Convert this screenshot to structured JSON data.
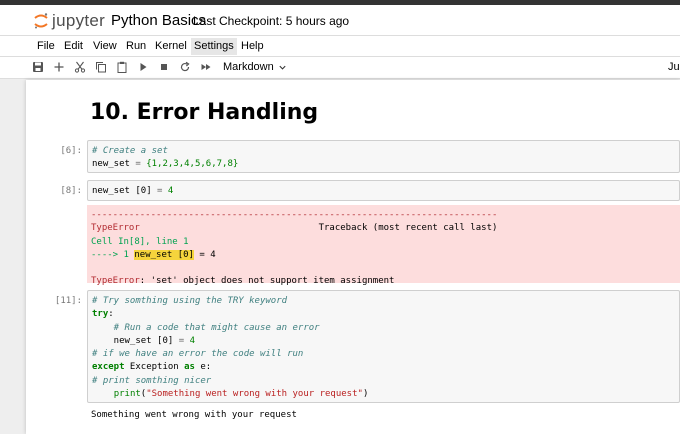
{
  "app": {
    "logo_text": "jupyter",
    "notebook_title": "Python Basics",
    "checkpoint": "Last Checkpoint: 5 hours ago",
    "kernel_name": "Jup"
  },
  "menu": [
    "File",
    "Edit",
    "View",
    "Run",
    "Kernel",
    "Settings",
    "Help"
  ],
  "toolbar": {
    "icons": [
      "save-icon",
      "add-icon",
      "cut-icon",
      "copy-icon",
      "paste-icon",
      "run-icon",
      "stop-icon",
      "restart-icon",
      "fast-forward-icon"
    ],
    "cell_type": "Markdown"
  },
  "heading": "10. Error Handling",
  "cells": {
    "c6": {
      "prompt": "[6]:",
      "line1": "# Create a set",
      "line2_var": "new_set",
      "line2_eq": " = ",
      "line2_val": "{1,2,3,4,5,6,7,8}"
    },
    "c8": {
      "prompt": "[8]:",
      "line1_var": "new_set ",
      "line1_idx": "[0]",
      "line1_eq": " = ",
      "line1_val": "4",
      "err_divider": "---------------------------------------------------------------------------",
      "err_type": "TypeError",
      "err_traceback": "                                 Traceback (most recent call last)",
      "err_cell": "Cell In[8], line 1",
      "err_arrow": "----> 1 ",
      "err_hl": "new_set [0]",
      "err_rest": " = 4",
      "err_msg_type": "TypeError",
      "err_msg": ": 'set' object does not support item assignment"
    },
    "c11": {
      "prompt": "[11]:",
      "l1": "# Try somthing using the TRY keyword",
      "l2_kw": "try",
      "l2_rest": ":",
      "l3": "    # Run a code that might cause an error",
      "l4_var": "    new_set ",
      "l4_idx": "[0]",
      "l4_eq": " = ",
      "l4_val": "4",
      "l5": "# if we have an error the code will run",
      "l6_kw": "except",
      "l6_mid": " Exception ",
      "l6_as": "as",
      "l6_end": " e:",
      "l7": "# print somthing nicer",
      "l8_indent": "    ",
      "l8_fn": "print",
      "l8_open": "(",
      "l8_str": "\"Something went wrong with your request\"",
      "l8_close": ")",
      "output": "Something went wrong with your request"
    }
  }
}
